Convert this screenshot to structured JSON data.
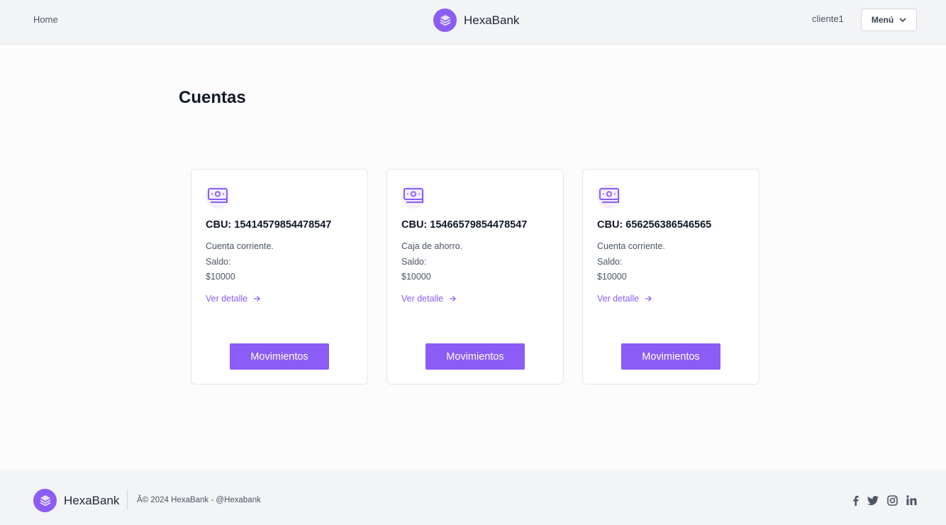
{
  "header": {
    "home_label": "Home",
    "brand_name": "HexaBank",
    "user_name": "cliente1",
    "menu_label": "Menú"
  },
  "main": {
    "title": "Cuentas",
    "accounts": [
      {
        "cbu": "CBU: 15414579854478547",
        "type": "Cuenta corriente.",
        "balance_label": "Saldo:",
        "balance": "$10000",
        "detail_label": "Ver detalle",
        "movements_label": "Movimientos"
      },
      {
        "cbu": "CBU: 15466579854478547",
        "type": "Caja de ahorro.",
        "balance_label": "Saldo:",
        "balance": "$10000",
        "detail_label": "Ver detalle",
        "movements_label": "Movimientos"
      },
      {
        "cbu": "CBU: 656256386546565",
        "type": "Cuenta corriente.",
        "balance_label": "Saldo:",
        "balance": "$10000",
        "detail_label": "Ver detalle",
        "movements_label": "Movimientos"
      }
    ]
  },
  "footer": {
    "brand_name": "HexaBank",
    "copyright": "Â© 2024 HexaBank  - @Hexabank",
    "social": [
      "facebook-icon",
      "twitter-icon",
      "instagram-icon",
      "linkedin-icon"
    ]
  },
  "colors": {
    "accent": "#8b5cf6",
    "header_bg": "#f3f4f6",
    "page_bg": "#fcfcfc"
  }
}
